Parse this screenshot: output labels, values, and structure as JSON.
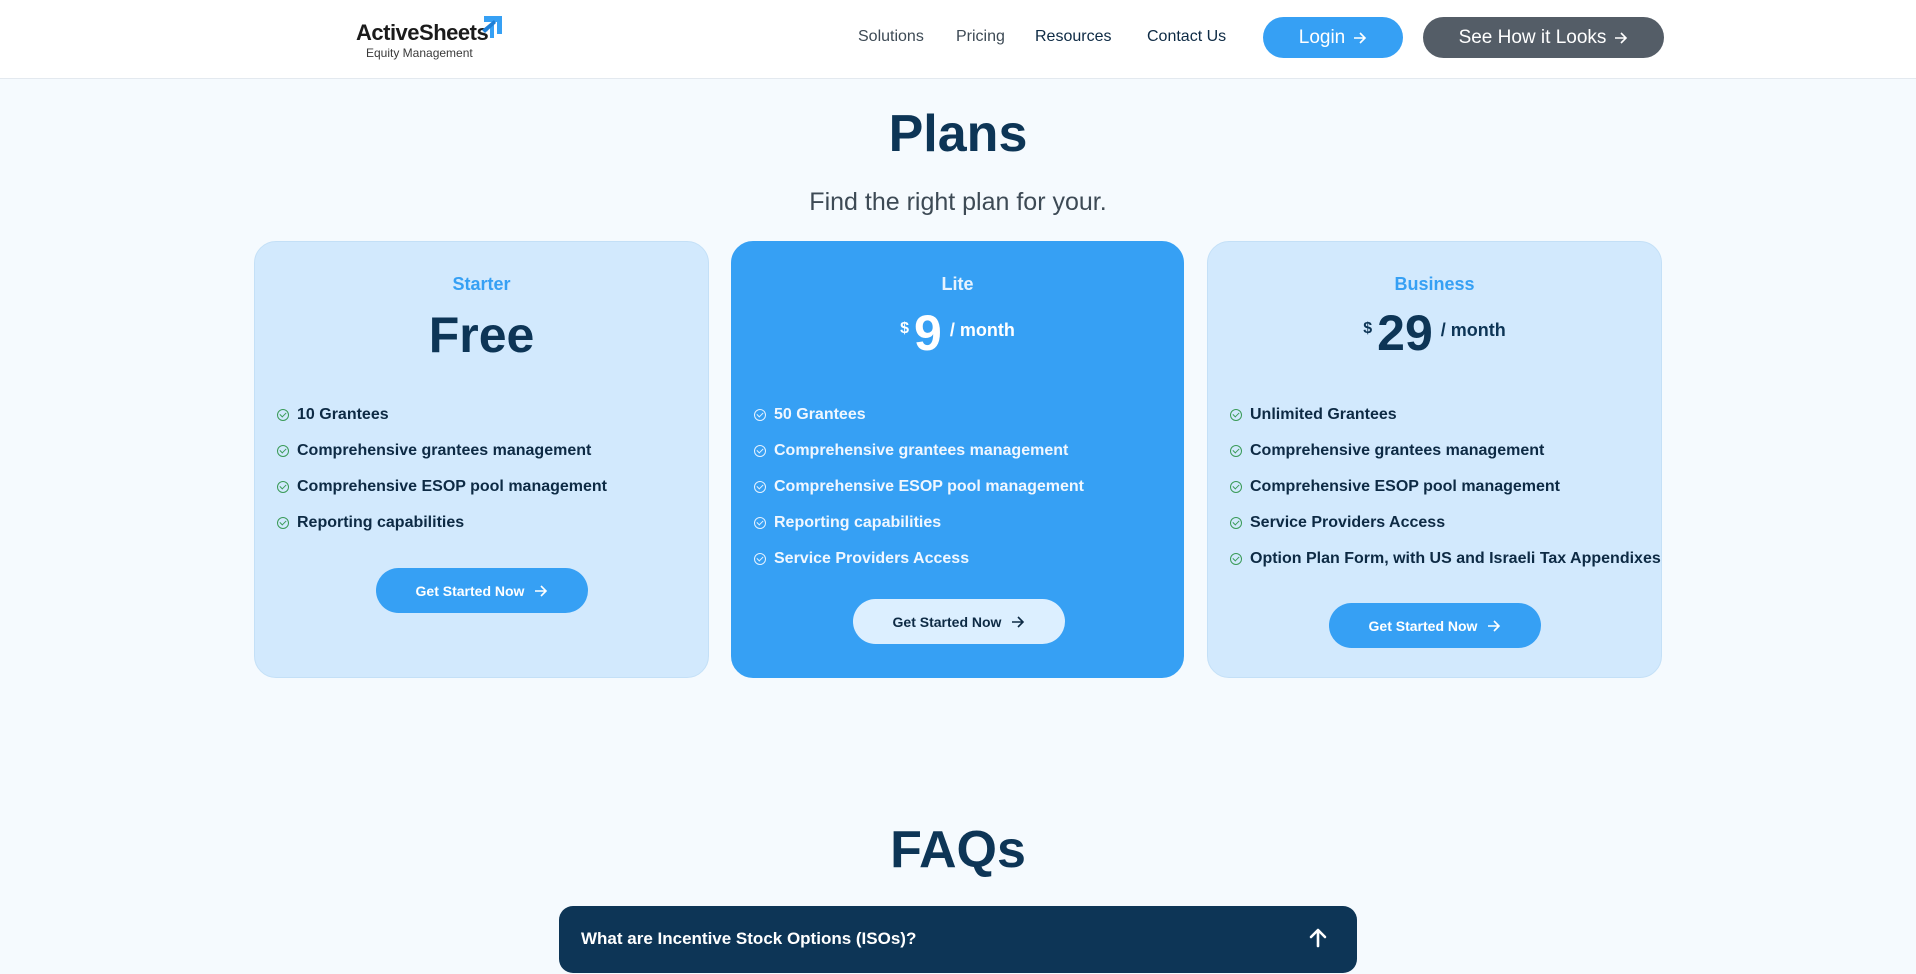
{
  "brand": {
    "name": "ActiveSheets",
    "tagline": "Equity Management",
    "accent": "#36a0f4",
    "dark": "#0d3556"
  },
  "nav": {
    "items": [
      "Solutions",
      "Pricing",
      "Resources",
      "Contact Us"
    ],
    "login": "Login",
    "see_how": "See How it Looks"
  },
  "plans": {
    "title": "Plans",
    "subtitle": "Find the right plan for your.",
    "cards": [
      {
        "name": "Starter",
        "price": "Free",
        "features": [
          "10 Grantees",
          "Comprehensive grantees management",
          "Comprehensive ESOP pool management",
          "Reporting capabilities"
        ],
        "cta": "Get Started Now"
      },
      {
        "name": "Lite",
        "currency": "$",
        "price": "9",
        "period": "/ month",
        "features": [
          "50 Grantees",
          "Comprehensive grantees management",
          "Comprehensive ESOP pool management",
          "Reporting capabilities",
          "Service Providers Access"
        ],
        "cta": "Get Started Now"
      },
      {
        "name": "Business",
        "currency": "$",
        "price": "29",
        "period": "/ month",
        "features": [
          "Unlimited Grantees",
          "Comprehensive grantees management",
          "Comprehensive ESOP pool management",
          "Service Providers Access",
          "Option Plan Form, with US and Israeli Tax Appendixes"
        ],
        "cta": "Get Started Now"
      }
    ]
  },
  "faq": {
    "title": "FAQs",
    "items": [
      {
        "question": "What are Incentive Stock Options (ISOs)?",
        "icon": "arrow-up-icon"
      }
    ]
  }
}
